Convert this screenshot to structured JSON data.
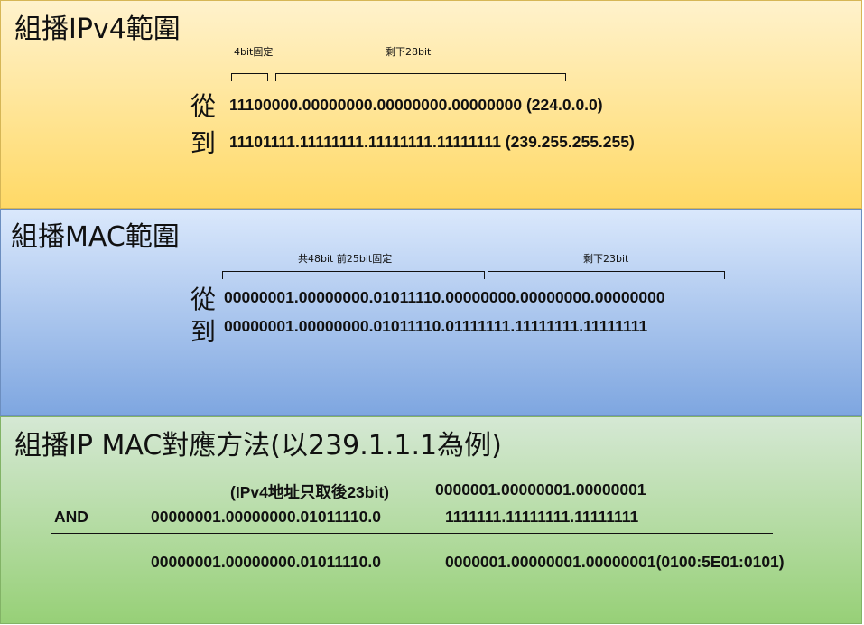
{
  "ipv4": {
    "title": "組播IPv4範圍",
    "label_fixed": "4bit固定",
    "label_rest": "剩下28bit",
    "from_label": "從",
    "to_label": "到",
    "from_value": "11100000.00000000.00000000.00000000 (224.0.0.0)",
    "to_value": "11101111.11111111.11111111.11111111 (239.255.255.255)"
  },
  "mac": {
    "title": "組播MAC範圍",
    "label_fixed": "共48bit 前25bit固定",
    "label_rest": "剩下23bit",
    "from_label": "從",
    "to_label": "到",
    "from_value": "00000001.00000000.01011110.00000000.00000000.00000000",
    "to_value": "00000001.00000000.01011110.01111111.11111111.11111111"
  },
  "mapping": {
    "title": "組播IP MAC對應方法(以239.1.1.1為例)",
    "ipv4_caption": "(IPv4地址只取後23bit)",
    "ipv4_bits": "0000001.00000001.00000001",
    "and_label": "AND",
    "mask_prefix": "00000001.00000000.01011110.0",
    "mask_bits": "1111111.11111111.11111111",
    "result_prefix": "00000001.00000000.01011110.0",
    "result_bits": "0000001.00000001.00000001(0100:5E01:0101)"
  },
  "colors": {
    "panel_ipv4": "#ffd966",
    "panel_mac": "#7ea6e0",
    "panel_mapping": "#97d077"
  }
}
